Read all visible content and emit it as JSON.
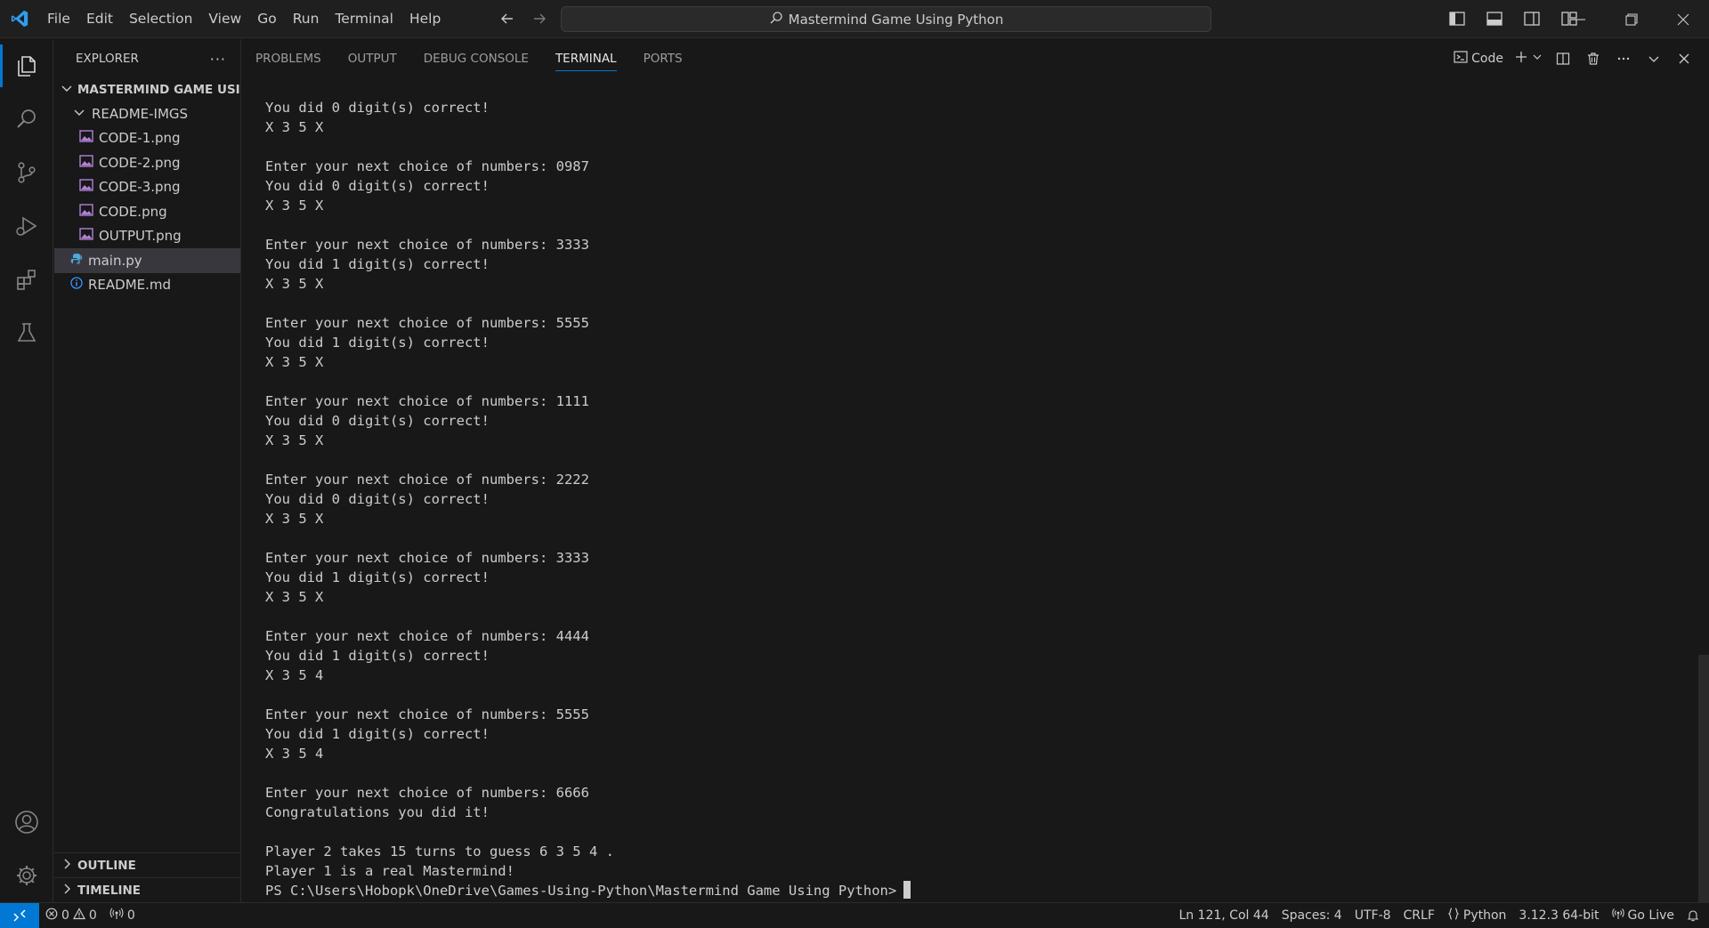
{
  "menu": [
    "File",
    "Edit",
    "Selection",
    "View",
    "Go",
    "Run",
    "Terminal",
    "Help"
  ],
  "command_center": {
    "text": "Mastermind Game Using Python"
  },
  "sidebar": {
    "title": "EXPLORER",
    "more": "···",
    "workspace": "MASTERMIND GAME USI...",
    "folder": "README-IMGS",
    "folder_files": [
      "CODE-1.png",
      "CODE-2.png",
      "CODE-3.png",
      "CODE.png",
      "OUTPUT.png"
    ],
    "root_files": [
      "main.py",
      "README.md"
    ],
    "outline": "OUTLINE",
    "timeline": "TIMELINE"
  },
  "panel": {
    "tabs": [
      "PROBLEMS",
      "OUTPUT",
      "DEBUG CONSOLE",
      "TERMINAL",
      "PORTS"
    ],
    "active_tab": "TERMINAL",
    "terminal_profile": "Code"
  },
  "terminal": {
    "lines": [
      "You did 0 digit(s) correct!",
      "X 3 5 X",
      "",
      "Enter your next choice of numbers: 0987",
      "You did 0 digit(s) correct!",
      "X 3 5 X",
      "",
      "Enter your next choice of numbers: 3333",
      "You did 1 digit(s) correct!",
      "X 3 5 X",
      "",
      "Enter your next choice of numbers: 5555",
      "You did 1 digit(s) correct!",
      "X 3 5 X",
      "",
      "Enter your next choice of numbers: 1111",
      "You did 0 digit(s) correct!",
      "X 3 5 X",
      "",
      "Enter your next choice of numbers: 2222",
      "You did 0 digit(s) correct!",
      "X 3 5 X",
      "",
      "Enter your next choice of numbers: 3333",
      "You did 1 digit(s) correct!",
      "X 3 5 X",
      "",
      "Enter your next choice of numbers: 4444",
      "You did 1 digit(s) correct!",
      "X 3 5 4",
      "",
      "Enter your next choice of numbers: 5555",
      "You did 1 digit(s) correct!",
      "X 3 5 4",
      "",
      "Enter your next choice of numbers: 6666",
      "Congratulations you did it!",
      "",
      "Player 2 takes 15 turns to guess 6 3 5 4 .",
      "Player 1 is a real Mastermind!"
    ],
    "prompt": "PS C:\\Users\\Hobopk\\OneDrive\\Games-Using-Python\\Mastermind Game Using Python>"
  },
  "statusbar": {
    "errors": "0",
    "warnings": "0",
    "ports": "0",
    "position": "Ln 121, Col 44",
    "spaces": "Spaces: 4",
    "encoding": "UTF-8",
    "eol": "CRLF",
    "language": "Python",
    "interpreter": "3.12.3 64-bit",
    "golive": "Go Live"
  },
  "colors": {
    "accent": "#0078d4",
    "background": "#181818",
    "python_icon": "#4fa8dc",
    "image_icon": "#b180d7",
    "info_icon": "#3794ff"
  },
  "icons": [
    "vscode-logo",
    "files-icon",
    "search-icon",
    "source-control-icon",
    "run-debug-icon",
    "extensions-icon",
    "testing-icon",
    "account-icon",
    "settings-gear-icon"
  ]
}
